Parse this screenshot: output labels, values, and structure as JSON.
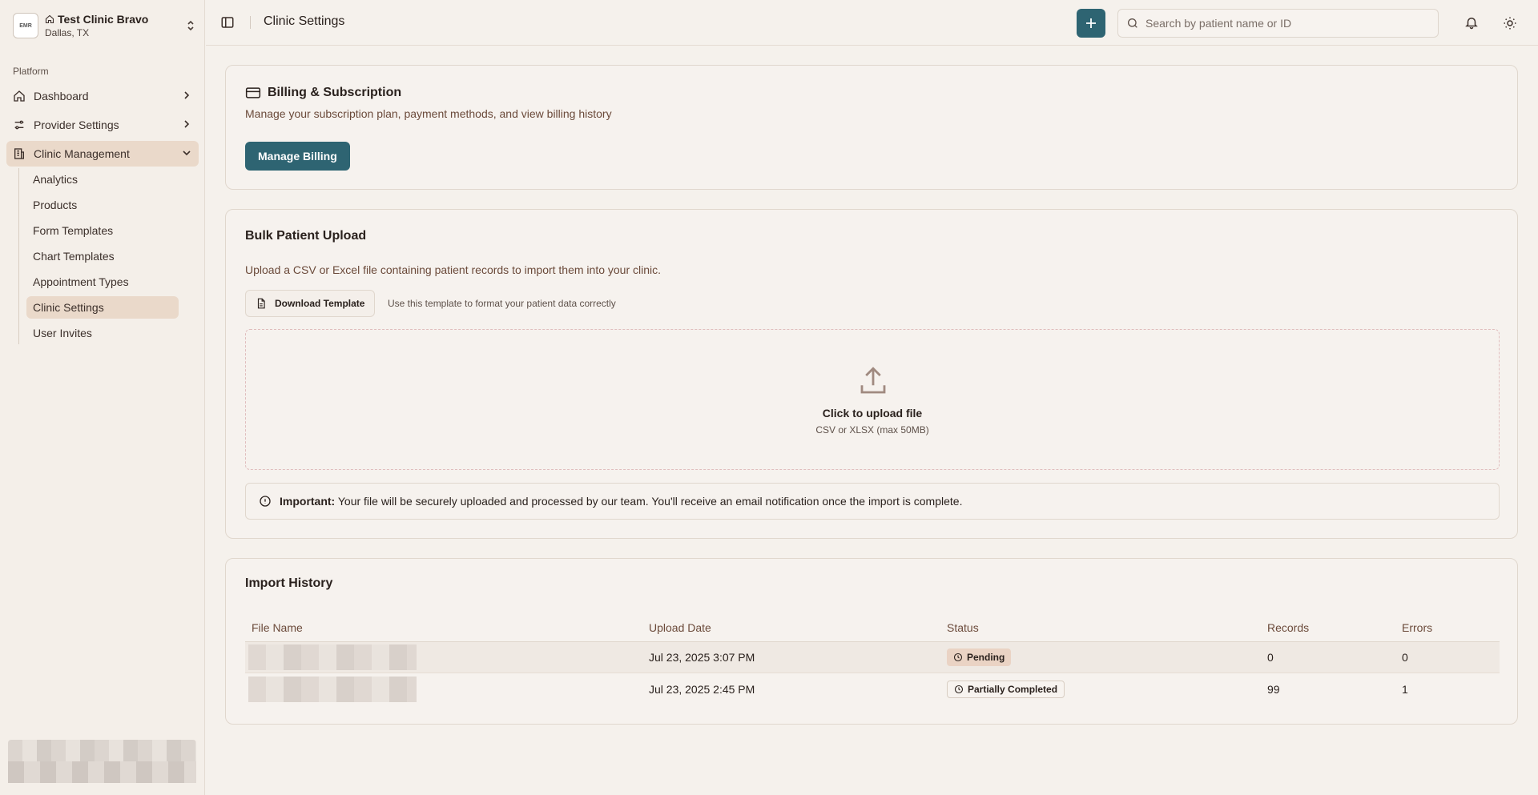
{
  "clinic": {
    "name": "Test Clinic Bravo",
    "location": "Dallas, TX",
    "logo_text": "EMR"
  },
  "sidebar": {
    "group_label": "Platform",
    "items": [
      {
        "label": "Dashboard"
      },
      {
        "label": "Provider Settings"
      },
      {
        "label": "Clinic Management"
      }
    ],
    "sub_items": [
      {
        "label": "Analytics"
      },
      {
        "label": "Products"
      },
      {
        "label": "Form Templates"
      },
      {
        "label": "Chart Templates"
      },
      {
        "label": "Appointment Types"
      },
      {
        "label": "Clinic Settings"
      },
      {
        "label": "User Invites"
      }
    ]
  },
  "topbar": {
    "page_title": "Clinic Settings",
    "add_label": "+",
    "search_placeholder": "Search by patient name or ID"
  },
  "billing": {
    "title": "Billing & Subscription",
    "description": "Manage your subscription plan, payment methods, and view billing history",
    "button_label": "Manage Billing"
  },
  "upload": {
    "title": "Bulk Patient Upload",
    "description": "Upload a CSV or Excel file containing patient records to import them into your clinic.",
    "download_label": "Download Template",
    "download_hint": "Use this template to format your patient data correctly",
    "drop_title": "Click to upload file",
    "drop_sub": "CSV or XLSX (max 50MB)",
    "notice_bold": "Important:",
    "notice_text": "Your file will be securely uploaded and processed by our team. You'll receive an email notification once the import is complete."
  },
  "history": {
    "title": "Import History",
    "columns": [
      "File Name",
      "Upload Date",
      "Status",
      "Records",
      "Errors"
    ],
    "rows": [
      {
        "date": "Jul 23, 2025 3:07 PM",
        "status": "Pending",
        "records": "0",
        "errors": "0"
      },
      {
        "date": "Jul 23, 2025 2:45 PM",
        "status": "Partially Completed",
        "records": "99",
        "errors": "1"
      }
    ]
  },
  "colors": {
    "accent": "#2e6472",
    "pending_badge": "#ead3c4",
    "active_nav": "#ead9ca"
  }
}
